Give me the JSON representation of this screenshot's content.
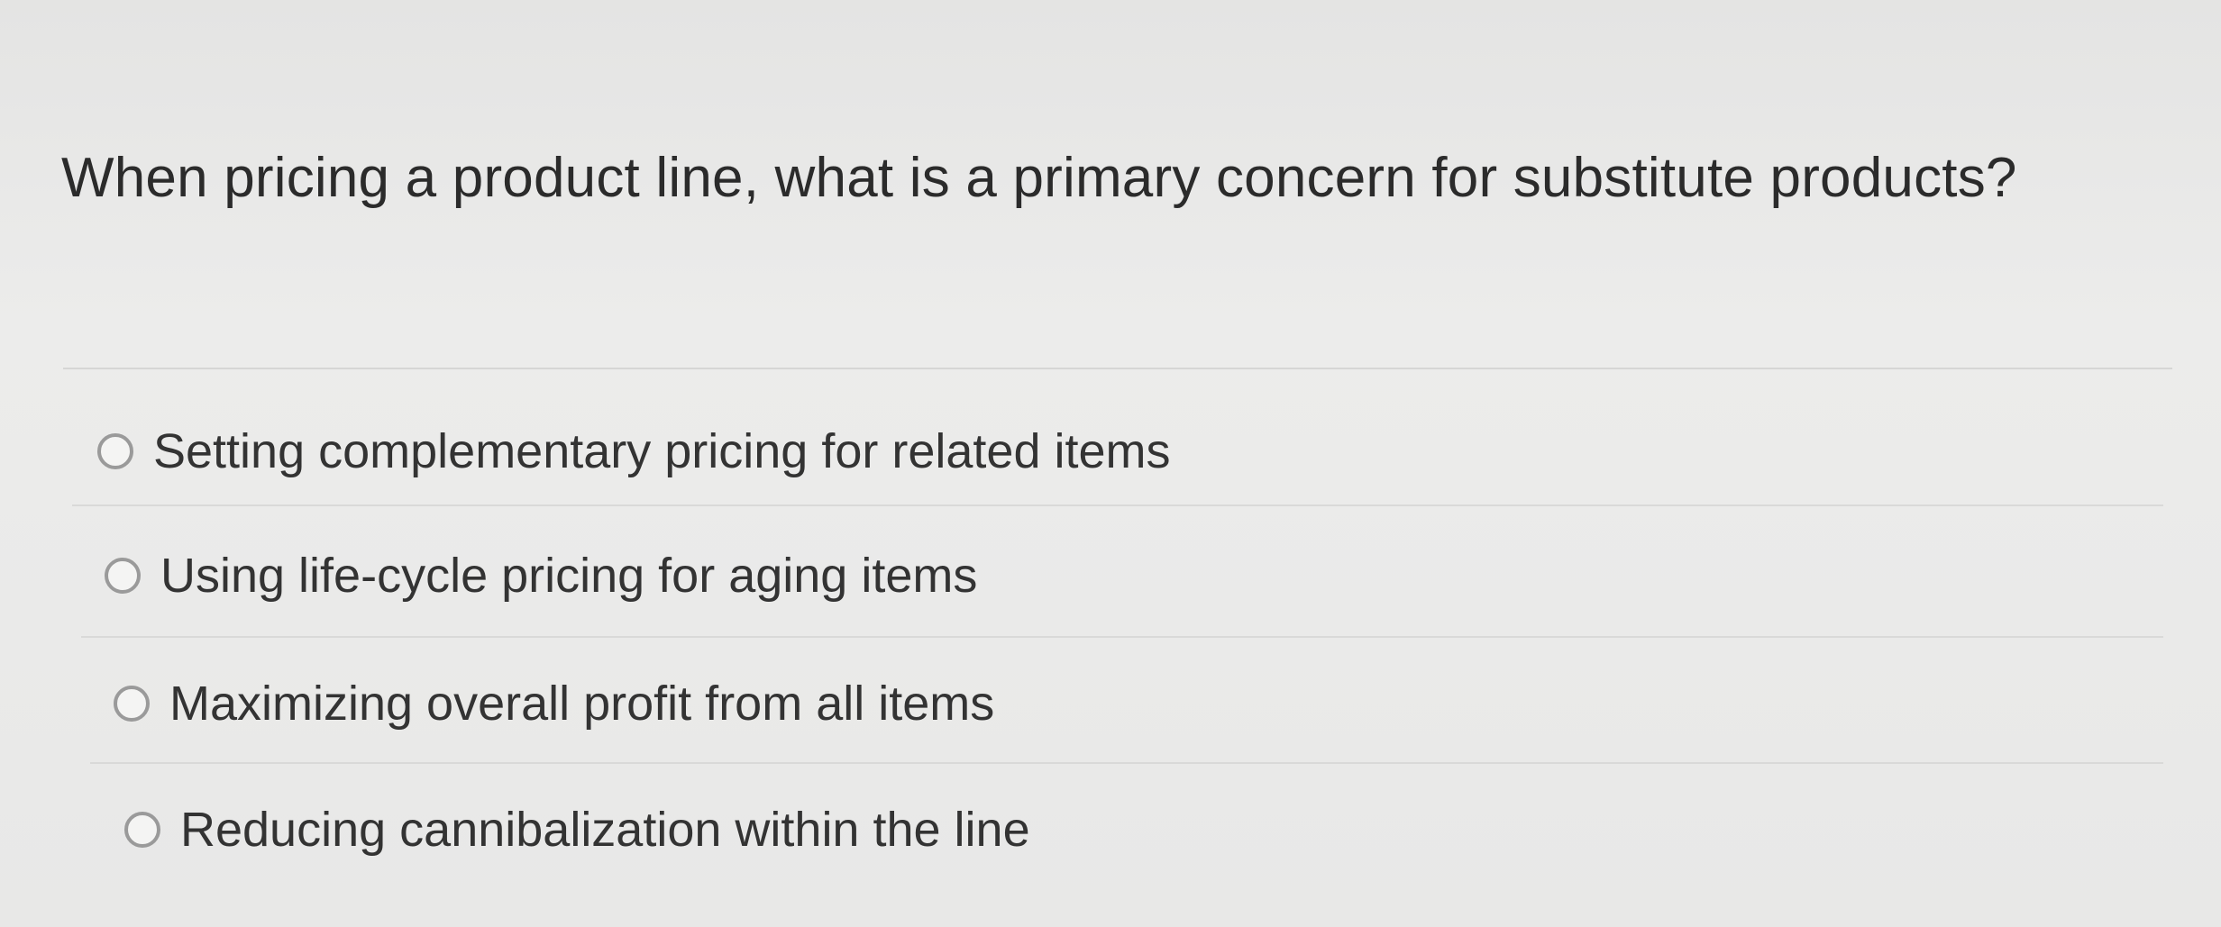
{
  "question": {
    "text": "When pricing a product line, what is a primary concern for substitute products?"
  },
  "options": [
    {
      "label": "Setting complementary pricing for related items",
      "selected": false
    },
    {
      "label": "Using life-cycle pricing for aging items",
      "selected": false
    },
    {
      "label": "Maximizing overall profit from all items",
      "selected": false
    },
    {
      "label": "Reducing cannibalization within the line",
      "selected": false
    }
  ]
}
